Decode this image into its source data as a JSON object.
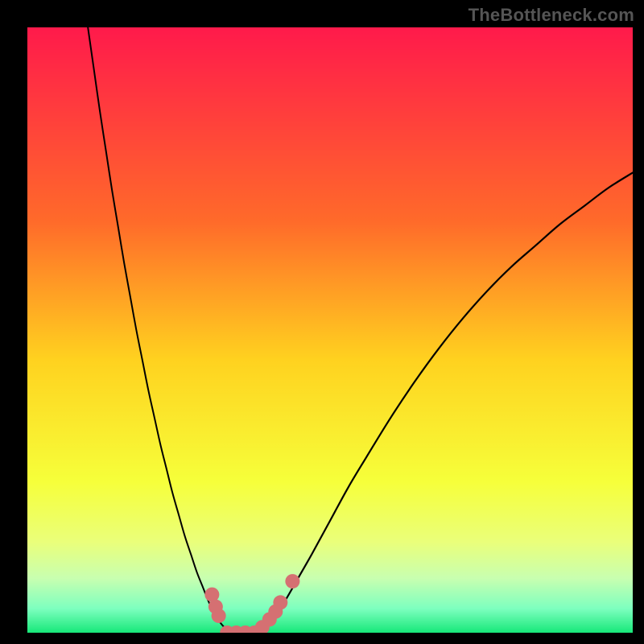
{
  "watermark": "TheBottleneck.com",
  "chart_data": {
    "type": "line",
    "title": "",
    "xlabel": "",
    "ylabel": "",
    "xlim": [
      0,
      100
    ],
    "ylim": [
      0,
      100
    ],
    "grid": false,
    "legend": false,
    "background_gradient_stops": [
      {
        "offset": 0.0,
        "color": "#ff1a4b"
      },
      {
        "offset": 0.32,
        "color": "#ff6a2a"
      },
      {
        "offset": 0.55,
        "color": "#ffd21f"
      },
      {
        "offset": 0.75,
        "color": "#f6ff3a"
      },
      {
        "offset": 0.85,
        "color": "#eaff7a"
      },
      {
        "offset": 0.91,
        "color": "#c8ffb0"
      },
      {
        "offset": 0.96,
        "color": "#7dffbf"
      },
      {
        "offset": 1.0,
        "color": "#17e879"
      }
    ],
    "series": [
      {
        "name": "left-curve",
        "stroke": "#000000",
        "stroke_width": 2.0,
        "points": [
          {
            "x": 10.0,
            "y": 100.0
          },
          {
            "x": 11.0,
            "y": 93.0
          },
          {
            "x": 12.0,
            "y": 86.0
          },
          {
            "x": 13.0,
            "y": 79.5
          },
          {
            "x": 14.0,
            "y": 73.0
          },
          {
            "x": 15.0,
            "y": 67.0
          },
          {
            "x": 16.0,
            "y": 61.0
          },
          {
            "x": 17.0,
            "y": 55.5
          },
          {
            "x": 18.0,
            "y": 50.0
          },
          {
            "x": 19.0,
            "y": 45.0
          },
          {
            "x": 20.0,
            "y": 40.0
          },
          {
            "x": 21.0,
            "y": 35.5
          },
          {
            "x": 22.0,
            "y": 31.0
          },
          {
            "x": 23.0,
            "y": 27.0
          },
          {
            "x": 24.0,
            "y": 23.0
          },
          {
            "x": 25.0,
            "y": 19.5
          },
          {
            "x": 26.0,
            "y": 16.0
          },
          {
            "x": 27.0,
            "y": 13.0
          },
          {
            "x": 28.0,
            "y": 10.0
          },
          {
            "x": 29.0,
            "y": 7.5
          },
          {
            "x": 30.0,
            "y": 5.0
          },
          {
            "x": 31.0,
            "y": 3.0
          },
          {
            "x": 32.0,
            "y": 1.5
          },
          {
            "x": 33.0,
            "y": 0.5
          },
          {
            "x": 34.0,
            "y": 0.0
          }
        ]
      },
      {
        "name": "right-curve",
        "stroke": "#000000",
        "stroke_width": 2.2,
        "points": [
          {
            "x": 38.0,
            "y": 0.0
          },
          {
            "x": 39.0,
            "y": 0.5
          },
          {
            "x": 40.0,
            "y": 1.5
          },
          {
            "x": 41.5,
            "y": 3.5
          },
          {
            "x": 43.0,
            "y": 6.0
          },
          {
            "x": 45.0,
            "y": 9.5
          },
          {
            "x": 47.0,
            "y": 13.0
          },
          {
            "x": 50.0,
            "y": 18.5
          },
          {
            "x": 53.0,
            "y": 24.0
          },
          {
            "x": 56.0,
            "y": 29.0
          },
          {
            "x": 60.0,
            "y": 35.5
          },
          {
            "x": 64.0,
            "y": 41.5
          },
          {
            "x": 68.0,
            "y": 47.0
          },
          {
            "x": 72.0,
            "y": 52.0
          },
          {
            "x": 76.0,
            "y": 56.5
          },
          {
            "x": 80.0,
            "y": 60.5
          },
          {
            "x": 84.0,
            "y": 64.0
          },
          {
            "x": 88.0,
            "y": 67.5
          },
          {
            "x": 92.0,
            "y": 70.5
          },
          {
            "x": 96.0,
            "y": 73.5
          },
          {
            "x": 100.0,
            "y": 76.0
          }
        ]
      }
    ],
    "markers": {
      "name": "bottom-markers",
      "fill": "#d57072",
      "radius": 9,
      "points": [
        {
          "x": 30.5,
          "y": 6.3
        },
        {
          "x": 31.1,
          "y": 4.3
        },
        {
          "x": 31.6,
          "y": 2.8
        },
        {
          "x": 33.0,
          "y": 0.0
        },
        {
          "x": 34.5,
          "y": 0.0
        },
        {
          "x": 36.0,
          "y": 0.0
        },
        {
          "x": 37.5,
          "y": 0.0
        },
        {
          "x": 38.8,
          "y": 0.9
        },
        {
          "x": 40.0,
          "y": 2.2
        },
        {
          "x": 41.0,
          "y": 3.5
        },
        {
          "x": 41.8,
          "y": 5.0
        },
        {
          "x": 43.8,
          "y": 8.5
        }
      ]
    }
  }
}
